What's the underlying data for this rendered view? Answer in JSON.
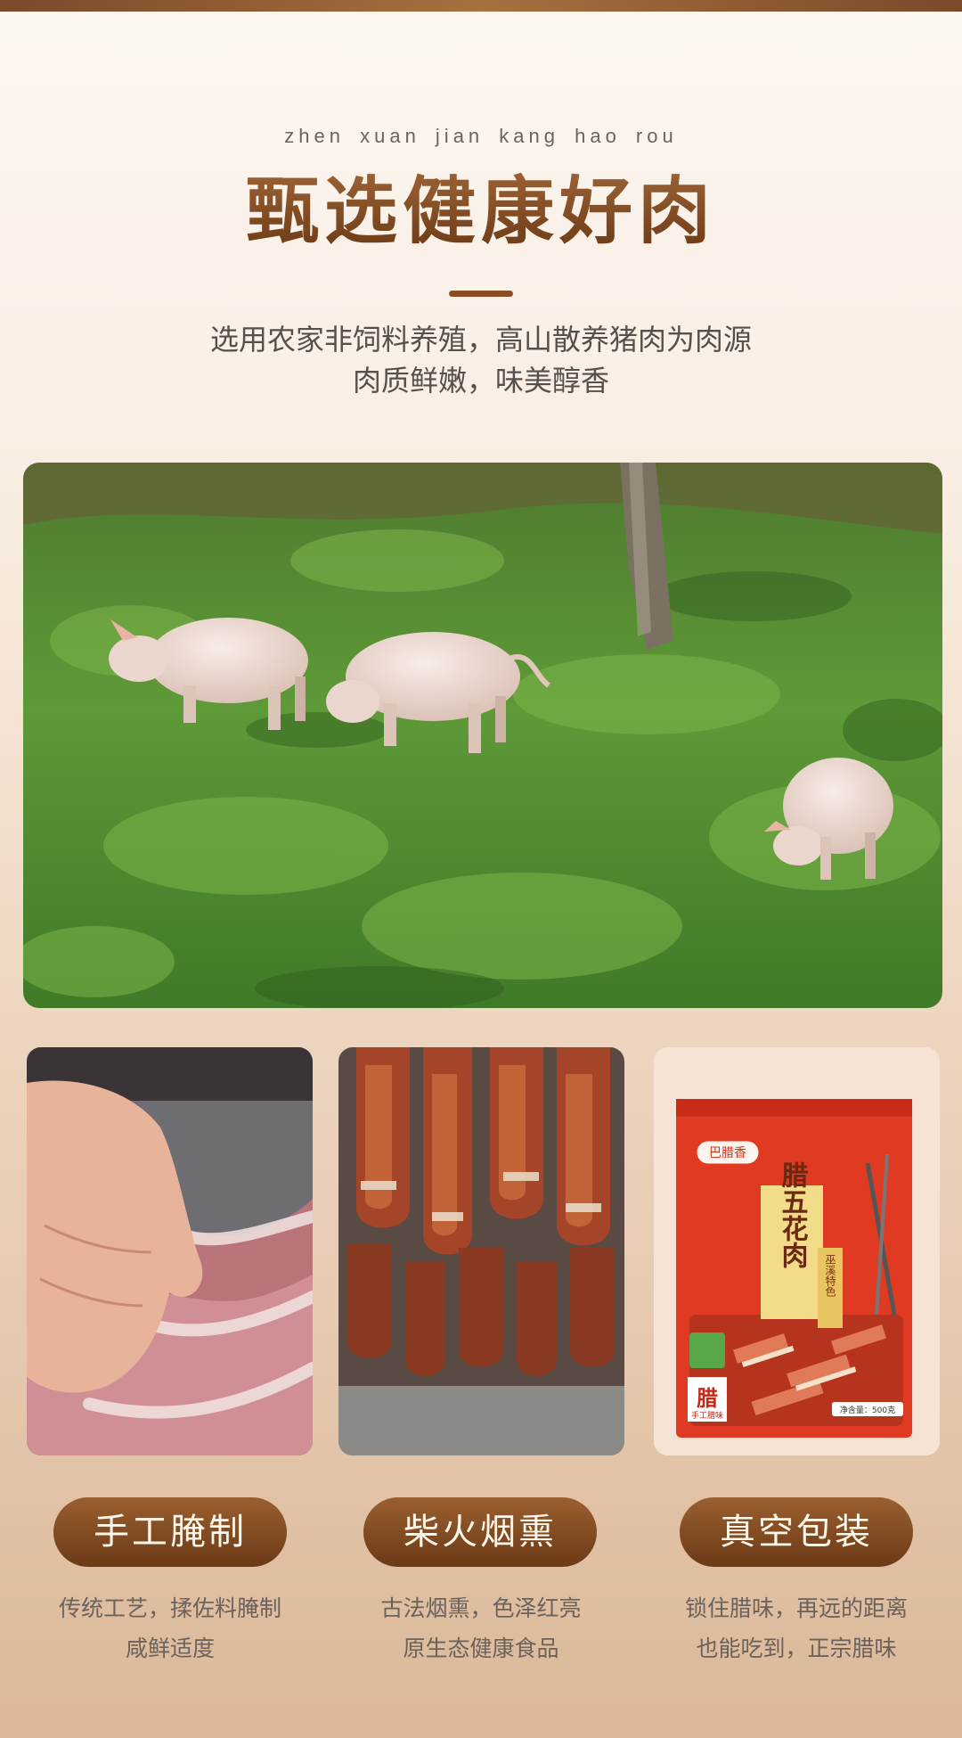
{
  "header": {
    "pinyin": "zhen xuan jian  kang hao   rou",
    "title": "甄选健康好肉",
    "subtitle_line1": "选用农家非饲料养殖，高山散养猪肉为肉源",
    "subtitle_line2": "肉质鲜嫩，味美醇香"
  },
  "colors": {
    "accent_brown": "#7a4622",
    "pill_brown": "#8b4e22",
    "text_gray": "#555049",
    "bag_red": "#e03a22"
  },
  "hero": {
    "image": "pigs-grazing-on-hillside-photo"
  },
  "features": [
    {
      "image": "hand-pressing-raw-pork-photo",
      "label": "手工腌制",
      "desc_line1": "传统工艺，揉佐料腌制",
      "desc_line2": "咸鲜适度"
    },
    {
      "image": "smoked-hanging-meat-photo",
      "label": "柴火烟熏",
      "desc_line1": "古法烟熏，色泽红亮",
      "desc_line2": "原生态健康食品"
    },
    {
      "image": "vacuum-package-photo",
      "label": "真空包装",
      "desc_line1": "锁住腊味，再远的距离",
      "desc_line2": "也能吃到，正宗腊味"
    }
  ],
  "package": {
    "brand": "巴腊香",
    "product": "腊五花肉",
    "badge": "腊",
    "badge_sub": "手工腊味",
    "tag": "巫溪特色",
    "weight": "净含量：500克"
  }
}
